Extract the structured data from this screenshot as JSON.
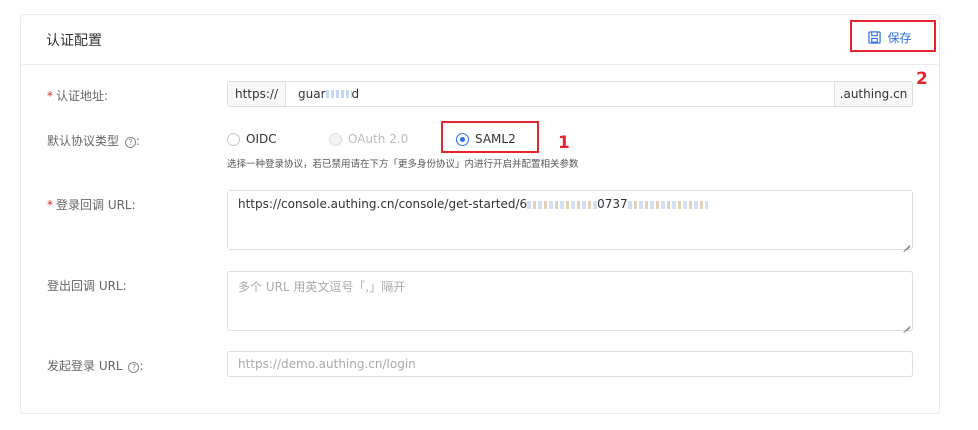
{
  "card": {
    "title": "认证配置",
    "save_label": "保存"
  },
  "fields": {
    "auth_address": {
      "label": "认证地址:",
      "prefix": "https://",
      "value_visible": "guar",
      "value_tail": "d",
      "suffix": ".authing.cn"
    },
    "protocol": {
      "label": "默认协议类型",
      "help": "?",
      "colon": ":",
      "options": [
        "OIDC",
        "OAuth 2.0",
        "SAML2"
      ],
      "selected": "SAML2",
      "disabled": "OAuth 2.0",
      "hint": "选择一种登录协议，若已禁用请在下方「更多身份协议」内进行开启并配置相关参数"
    },
    "login_callback": {
      "label": "登录回调 URL:",
      "value": "https://console.authing.cn/console/get-started/6",
      "value_partial": "0737"
    },
    "logout_callback": {
      "label": "登出回调 URL:",
      "placeholder": "多个 URL 用英文逗号「,」隔开"
    },
    "initiate_login": {
      "label": "发起登录 URL",
      "help": "?",
      "colon": ":",
      "placeholder": "https://demo.authing.cn/login"
    }
  },
  "annotations": {
    "one": "1",
    "two": "2"
  },
  "colors": {
    "accent": "#2f6fe4",
    "callout": "#e5262e",
    "border": "#dcdee2"
  }
}
